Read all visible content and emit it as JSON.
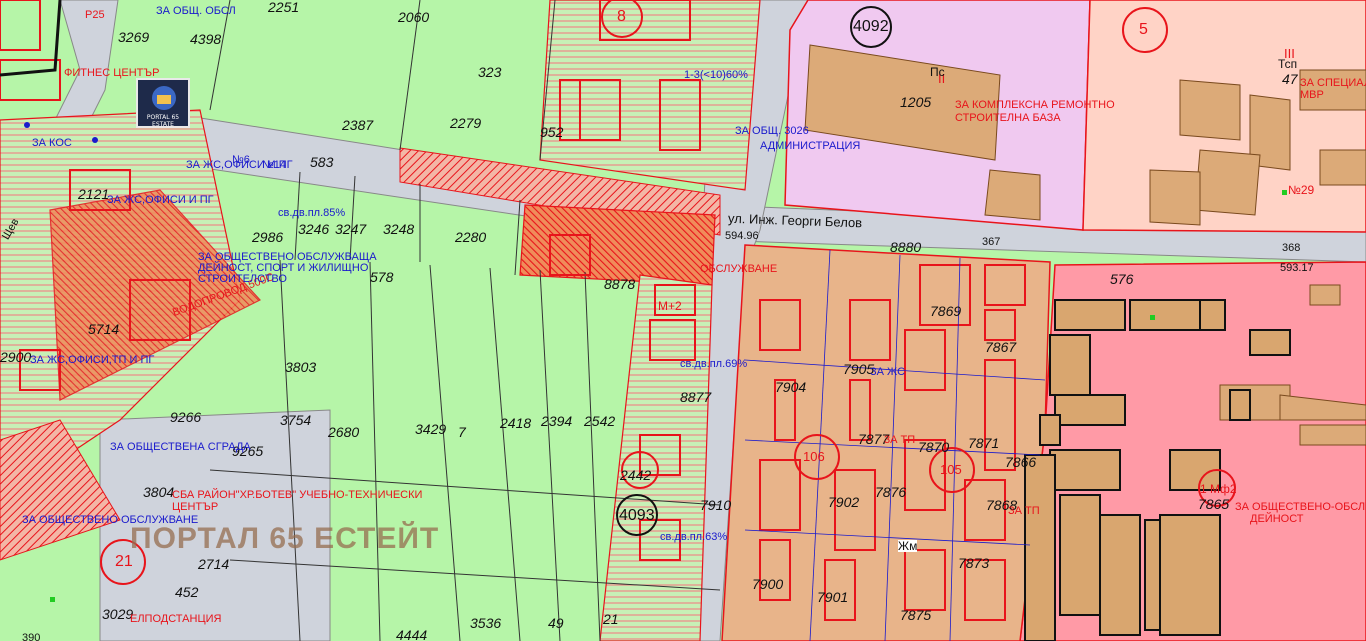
{
  "streets": {
    "street_name": "ул. Инж. Георги Белов",
    "west_street": "Щев"
  },
  "watermark": "ПОРТАЛ 65 ЕСТЕЙТ",
  "logo_text": "PORTAL 65 ESTATE",
  "numbers": {
    "p2251": "2251",
    "p2060": "2060",
    "p4398": "4398",
    "p3269": "3269",
    "p323": "323",
    "p2387": "2387",
    "p2279": "2279",
    "p952": "952",
    "p583": "583",
    "p2986": "2986",
    "p3246": "3246",
    "p3247": "3247",
    "p3248": "3248",
    "p2280": "2280",
    "p578": "578",
    "p3803": "3803",
    "p9266": "9266",
    "p9265": "9265",
    "p3754": "3754",
    "p2680": "2680",
    "p3429": "3429",
    "p7": "7",
    "p2418": "2418",
    "p2394": "2394",
    "p2542": "2542",
    "p3804": "3804",
    "p2714": "2714",
    "p452": "452",
    "p3029": "3029",
    "p3536": "3536",
    "p49": "49",
    "p21": "21",
    "p4444": "4444",
    "p1205": "1205",
    "p8880": "8880",
    "p576": "576",
    "p7910": "7910",
    "p8877": "8877",
    "p8878": "8878",
    "p2442": "2442",
    "p7904": "7904",
    "p7905": "7905",
    "p7869": "7869",
    "p7867": "7867",
    "p7902": "7902",
    "p7876": "7876",
    "p7870": "7870",
    "p7871": "7871",
    "p7866": "7866",
    "p7900": "7900",
    "p7901": "7901",
    "p7875": "7875",
    "p7873": "7873",
    "p7868": "7868",
    "p7877": "7877",
    "p7865": "7865",
    "p2900": "2900",
    "p2121": "2121",
    "p5714": "5714",
    "p47": "47",
    "p390": "390",
    "p367": "367",
    "p368": "368",
    "p594_96": "594.96",
    "p593_17": "593.17"
  },
  "circles": {
    "c4092": "4092",
    "c4093": "4093",
    "c5": "5",
    "c8": "8",
    "c106": "106",
    "c105": "105",
    "c21": "21",
    "c1_64": "1 Мф2"
  },
  "red_labels": {
    "fitness": "ФИТНЕС ЦЕНТЪР",
    "p25": "P25",
    "za_remont": "ЗА КОМПЛЕКСНА РЕМОНТНО",
    "stroit_baza": "СТРОИТЕЛНА БАЗА",
    "za_special_1": "ЗА СПЕЦИАЛ",
    "za_special_2": "МВР",
    "ob_obsluzh": "ОБСЛУЖВАНЕ",
    "sba_1": "СБА РАЙОН\"ХР.БОТЕВ\" УЧЕБНО-ТЕХНИЧЕСКИ",
    "sba_2": "ЦЕНТЪР",
    "elpodst": "ЕЛПОДСТАНЦИЯ",
    "za_obsht_2": "ЗА ОБЩЕСТВЕНО-ОБСЛУЖ",
    "deynost": "ДЕЙНОСТ",
    "vodoprovod": "ВОДОПРОВОД 500С",
    "m2": "М+2",
    "roman_iii": "III",
    "roman_ii": "II",
    "tsp": "Тсп",
    "ps": "Пс",
    "zhm": "Жм",
    "n29": "№29"
  },
  "blue_labels": {
    "za_obsht_obsl": "ЗА ОБЩ. ОБСЛ",
    "za_kos": "ЗА КОС",
    "za_zhs_ofisi_pg": "ЗА ЖС,ОФИСИ И ПГ",
    "za_zhs_ofisi_pg_2": "ЗА ЖС,ОФИСИ И ПГ",
    "za_zhs_ofisi_tp": "ЗА ЖС,ОФИСИ,ТП И ПГ",
    "za_obsht_obsl_1": "ЗА ОБЩЕСТВЕНО ОБСЛУЖВАЩА",
    "za_obsht_obsl_2": "ДЕЙНОСТ, СПОРТ И ЖИЛИЩНО",
    "za_obsht_obsl_3": "СТРОИТЕЛСТВО",
    "za_obsht_adm": "ЗА ОБЩ. 3026",
    "administracia": "АДМИНИСТРАЦИЯ",
    "za_obsht_sgrada": "ЗА ОБЩЕСТВЕНА СГРАДА",
    "za_obsluzh_2": "ЗА ОБЩЕСТВЕНО ОБСЛУЖВАНЕ",
    "sv_dv_pl_85": "св.дв.пл.85%",
    "sv_dv_pl_69": "св.дв.пл.69%",
    "sv_dv_pl_63": "св.дв.пл.63%",
    "za_zhs": "ЗА ЖС",
    "za_tp": "ЗА ТП",
    "za_tp_2": "3А ТП",
    "n14": "№14",
    "n6": "№6",
    "plus_60": "1-3(<10)60%"
  }
}
